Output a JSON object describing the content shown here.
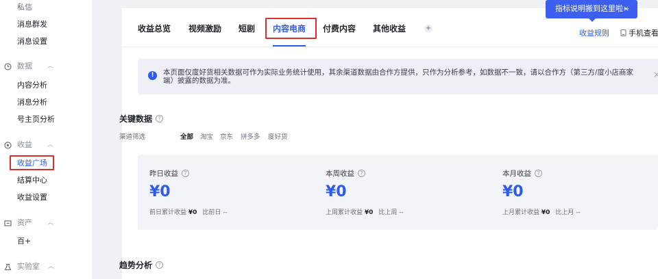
{
  "sidebar": {
    "items": [
      {
        "label": "私信"
      },
      {
        "label": "消息群发"
      },
      {
        "label": "消息设置"
      }
    ],
    "groups": [
      {
        "label": "数据",
        "icon": "clock-icon",
        "items": [
          "内容分析",
          "消息分析",
          "号主页分析"
        ]
      },
      {
        "label": "收益",
        "icon": "coin-icon",
        "items": [
          "收益广场",
          "结算中心",
          "收益设置"
        ]
      },
      {
        "label": "资产",
        "icon": "wallet-icon",
        "items": [
          "百+"
        ]
      },
      {
        "label": "实验室",
        "icon": "lab-icon",
        "items": []
      }
    ],
    "active_item": "收益广场"
  },
  "tabs": [
    {
      "label": "收益总览"
    },
    {
      "label": "视频激励"
    },
    {
      "label": "短剧"
    },
    {
      "label": "内容电商",
      "active": true
    },
    {
      "label": "付费内容"
    },
    {
      "label": "其他收益"
    }
  ],
  "header": {
    "plus": "+",
    "rule_link": "收益规则",
    "phone_view": "手机查看",
    "tooltip": "指标说明搬到这里啦~",
    "tooltip_close": "×"
  },
  "notice": {
    "text": "本页面仅度好货相关数据可作为实际业务统计使用，其余渠道数据由合作方提供，只作为分析参考，如数据不一致，请以合作方（第三方/度小店商家端）披露的数据为准。",
    "close": "×"
  },
  "key_data": {
    "title": "关键数据",
    "filter_label": "渠道筛选",
    "filters": [
      "全部",
      "淘宝",
      "京东",
      "拼多多",
      "度好货"
    ],
    "active_filter": "全部",
    "cards": [
      {
        "label": "昨日收益",
        "value": "¥0",
        "sub_label": "前日累计收益",
        "sub_value": "¥0",
        "compare_label": "比前日",
        "compare_value": "--"
      },
      {
        "label": "本周收益",
        "value": "¥0",
        "sub_label": "上周累计收益",
        "sub_value": "¥0",
        "compare_label": "比上周",
        "compare_value": "--"
      },
      {
        "label": "本月收益",
        "value": "¥0",
        "sub_label": "上月累计收益",
        "sub_value": "¥0",
        "compare_label": "比上月",
        "compare_value": "--"
      }
    ]
  },
  "trend": {
    "title": "趋势分析"
  },
  "colors": {
    "accent": "#2f5bea",
    "highlight": "#e02b2b",
    "tooltip": "#3c5ff0"
  }
}
